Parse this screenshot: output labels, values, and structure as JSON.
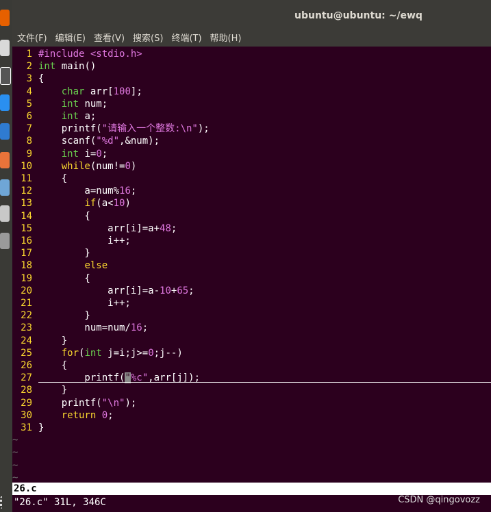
{
  "window": {
    "title": "ubuntu@ubuntu: ~/ewq"
  },
  "menu": [
    "文件(F)",
    "编辑(E)",
    "查看(V)",
    "搜索(S)",
    "终端(T)",
    "帮助(H)"
  ],
  "code_lines": [
    {
      "n": "1",
      "t": [
        [
          "inc",
          "#include "
        ],
        [
          "hdr",
          "<stdio.h>"
        ]
      ]
    },
    {
      "n": "2",
      "t": [
        [
          "tp",
          "int"
        ],
        [
          "plain",
          " main()"
        ]
      ]
    },
    {
      "n": "3",
      "t": [
        [
          "plain",
          "{"
        ]
      ]
    },
    {
      "n": "4",
      "t": [
        [
          "plain",
          "    "
        ],
        [
          "tp",
          "char"
        ],
        [
          "plain",
          " arr["
        ],
        [
          "num",
          "100"
        ],
        [
          "plain",
          "];"
        ]
      ]
    },
    {
      "n": "5",
      "t": [
        [
          "plain",
          "    "
        ],
        [
          "tp",
          "int"
        ],
        [
          "plain",
          " num;"
        ]
      ]
    },
    {
      "n": "6",
      "t": [
        [
          "plain",
          "    "
        ],
        [
          "tp",
          "int"
        ],
        [
          "plain",
          " a;"
        ]
      ]
    },
    {
      "n": "7",
      "t": [
        [
          "plain",
          "    printf("
        ],
        [
          "str",
          "\"请输入一个整数:\\n\""
        ],
        [
          "plain",
          ");"
        ]
      ]
    },
    {
      "n": "8",
      "t": [
        [
          "plain",
          "    scanf("
        ],
        [
          "str",
          "\"%d\""
        ],
        [
          "plain",
          ",&num);"
        ]
      ]
    },
    {
      "n": "9",
      "t": [
        [
          "plain",
          "    "
        ],
        [
          "tp",
          "int"
        ],
        [
          "plain",
          " i="
        ],
        [
          "num",
          "0"
        ],
        [
          "plain",
          ";"
        ]
      ]
    },
    {
      "n": "10",
      "t": [
        [
          "plain",
          "    "
        ],
        [
          "kw",
          "while"
        ],
        [
          "plain",
          "(num!="
        ],
        [
          "num",
          "0"
        ],
        [
          "plain",
          ")"
        ]
      ]
    },
    {
      "n": "11",
      "t": [
        [
          "plain",
          "    {"
        ]
      ]
    },
    {
      "n": "12",
      "t": [
        [
          "plain",
          "        a=num%"
        ],
        [
          "num",
          "16"
        ],
        [
          "plain",
          ";"
        ]
      ]
    },
    {
      "n": "13",
      "t": [
        [
          "plain",
          "        "
        ],
        [
          "kw",
          "if"
        ],
        [
          "plain",
          "(a<"
        ],
        [
          "num",
          "10"
        ],
        [
          "plain",
          ")"
        ]
      ]
    },
    {
      "n": "14",
      "t": [
        [
          "plain",
          "        {"
        ]
      ]
    },
    {
      "n": "15",
      "t": [
        [
          "plain",
          "            arr[i]=a+"
        ],
        [
          "num",
          "48"
        ],
        [
          "plain",
          ";"
        ]
      ]
    },
    {
      "n": "16",
      "t": [
        [
          "plain",
          "            i++;"
        ]
      ]
    },
    {
      "n": "17",
      "t": [
        [
          "plain",
          "        }"
        ]
      ]
    },
    {
      "n": "18",
      "t": [
        [
          "plain",
          "        "
        ],
        [
          "kw",
          "else"
        ]
      ]
    },
    {
      "n": "19",
      "t": [
        [
          "plain",
          "        {"
        ]
      ]
    },
    {
      "n": "20",
      "t": [
        [
          "plain",
          "            arr[i]=a-"
        ],
        [
          "num",
          "10"
        ],
        [
          "plain",
          "+"
        ],
        [
          "num",
          "65"
        ],
        [
          "plain",
          ";"
        ]
      ]
    },
    {
      "n": "21",
      "t": [
        [
          "plain",
          "            i++;"
        ]
      ]
    },
    {
      "n": "22",
      "t": [
        [
          "plain",
          "        }"
        ]
      ]
    },
    {
      "n": "23",
      "t": [
        [
          "plain",
          "        num=num/"
        ],
        [
          "num",
          "16"
        ],
        [
          "plain",
          ";"
        ]
      ]
    },
    {
      "n": "24",
      "t": [
        [
          "plain",
          "    }"
        ]
      ]
    },
    {
      "n": "25",
      "t": [
        [
          "plain",
          "    "
        ],
        [
          "kw",
          "for"
        ],
        [
          "plain",
          "("
        ],
        [
          "tp",
          "int"
        ],
        [
          "plain",
          " j=i;j>="
        ],
        [
          "num",
          "0"
        ],
        [
          "plain",
          ";j--)"
        ]
      ]
    },
    {
      "n": "26",
      "t": [
        [
          "plain",
          "    {"
        ]
      ]
    },
    {
      "n": "27",
      "t": [
        [
          "plain",
          "        printf("
        ],
        [
          "cursor",
          "\""
        ],
        [
          "str",
          "%c\""
        ],
        [
          "plain",
          ",arr[j]);"
        ]
      ]
    },
    {
      "n": "28",
      "t": [
        [
          "plain",
          "    }"
        ]
      ]
    },
    {
      "n": "29",
      "t": [
        [
          "plain",
          "    printf("
        ],
        [
          "str",
          "\"\\n\""
        ],
        [
          "plain",
          ");"
        ]
      ]
    },
    {
      "n": "30",
      "t": [
        [
          "plain",
          "    "
        ],
        [
          "kw",
          "return"
        ],
        [
          "plain",
          " "
        ],
        [
          "num",
          "0"
        ],
        [
          "plain",
          ";"
        ]
      ]
    },
    {
      "n": "31",
      "t": [
        [
          "plain",
          "}"
        ]
      ]
    }
  ],
  "tildes": [
    "~",
    "~",
    "~",
    "~"
  ],
  "status_line": "26.c",
  "message_line": "\"26.c\" 31L, 346C",
  "watermark": "CSDN @qingovozz",
  "colors": {
    "background": "#2c001e",
    "line_number": "#fcd92f",
    "keyword": "#fcd92f",
    "type": "#6ad14f",
    "constant": "#e078e0"
  }
}
